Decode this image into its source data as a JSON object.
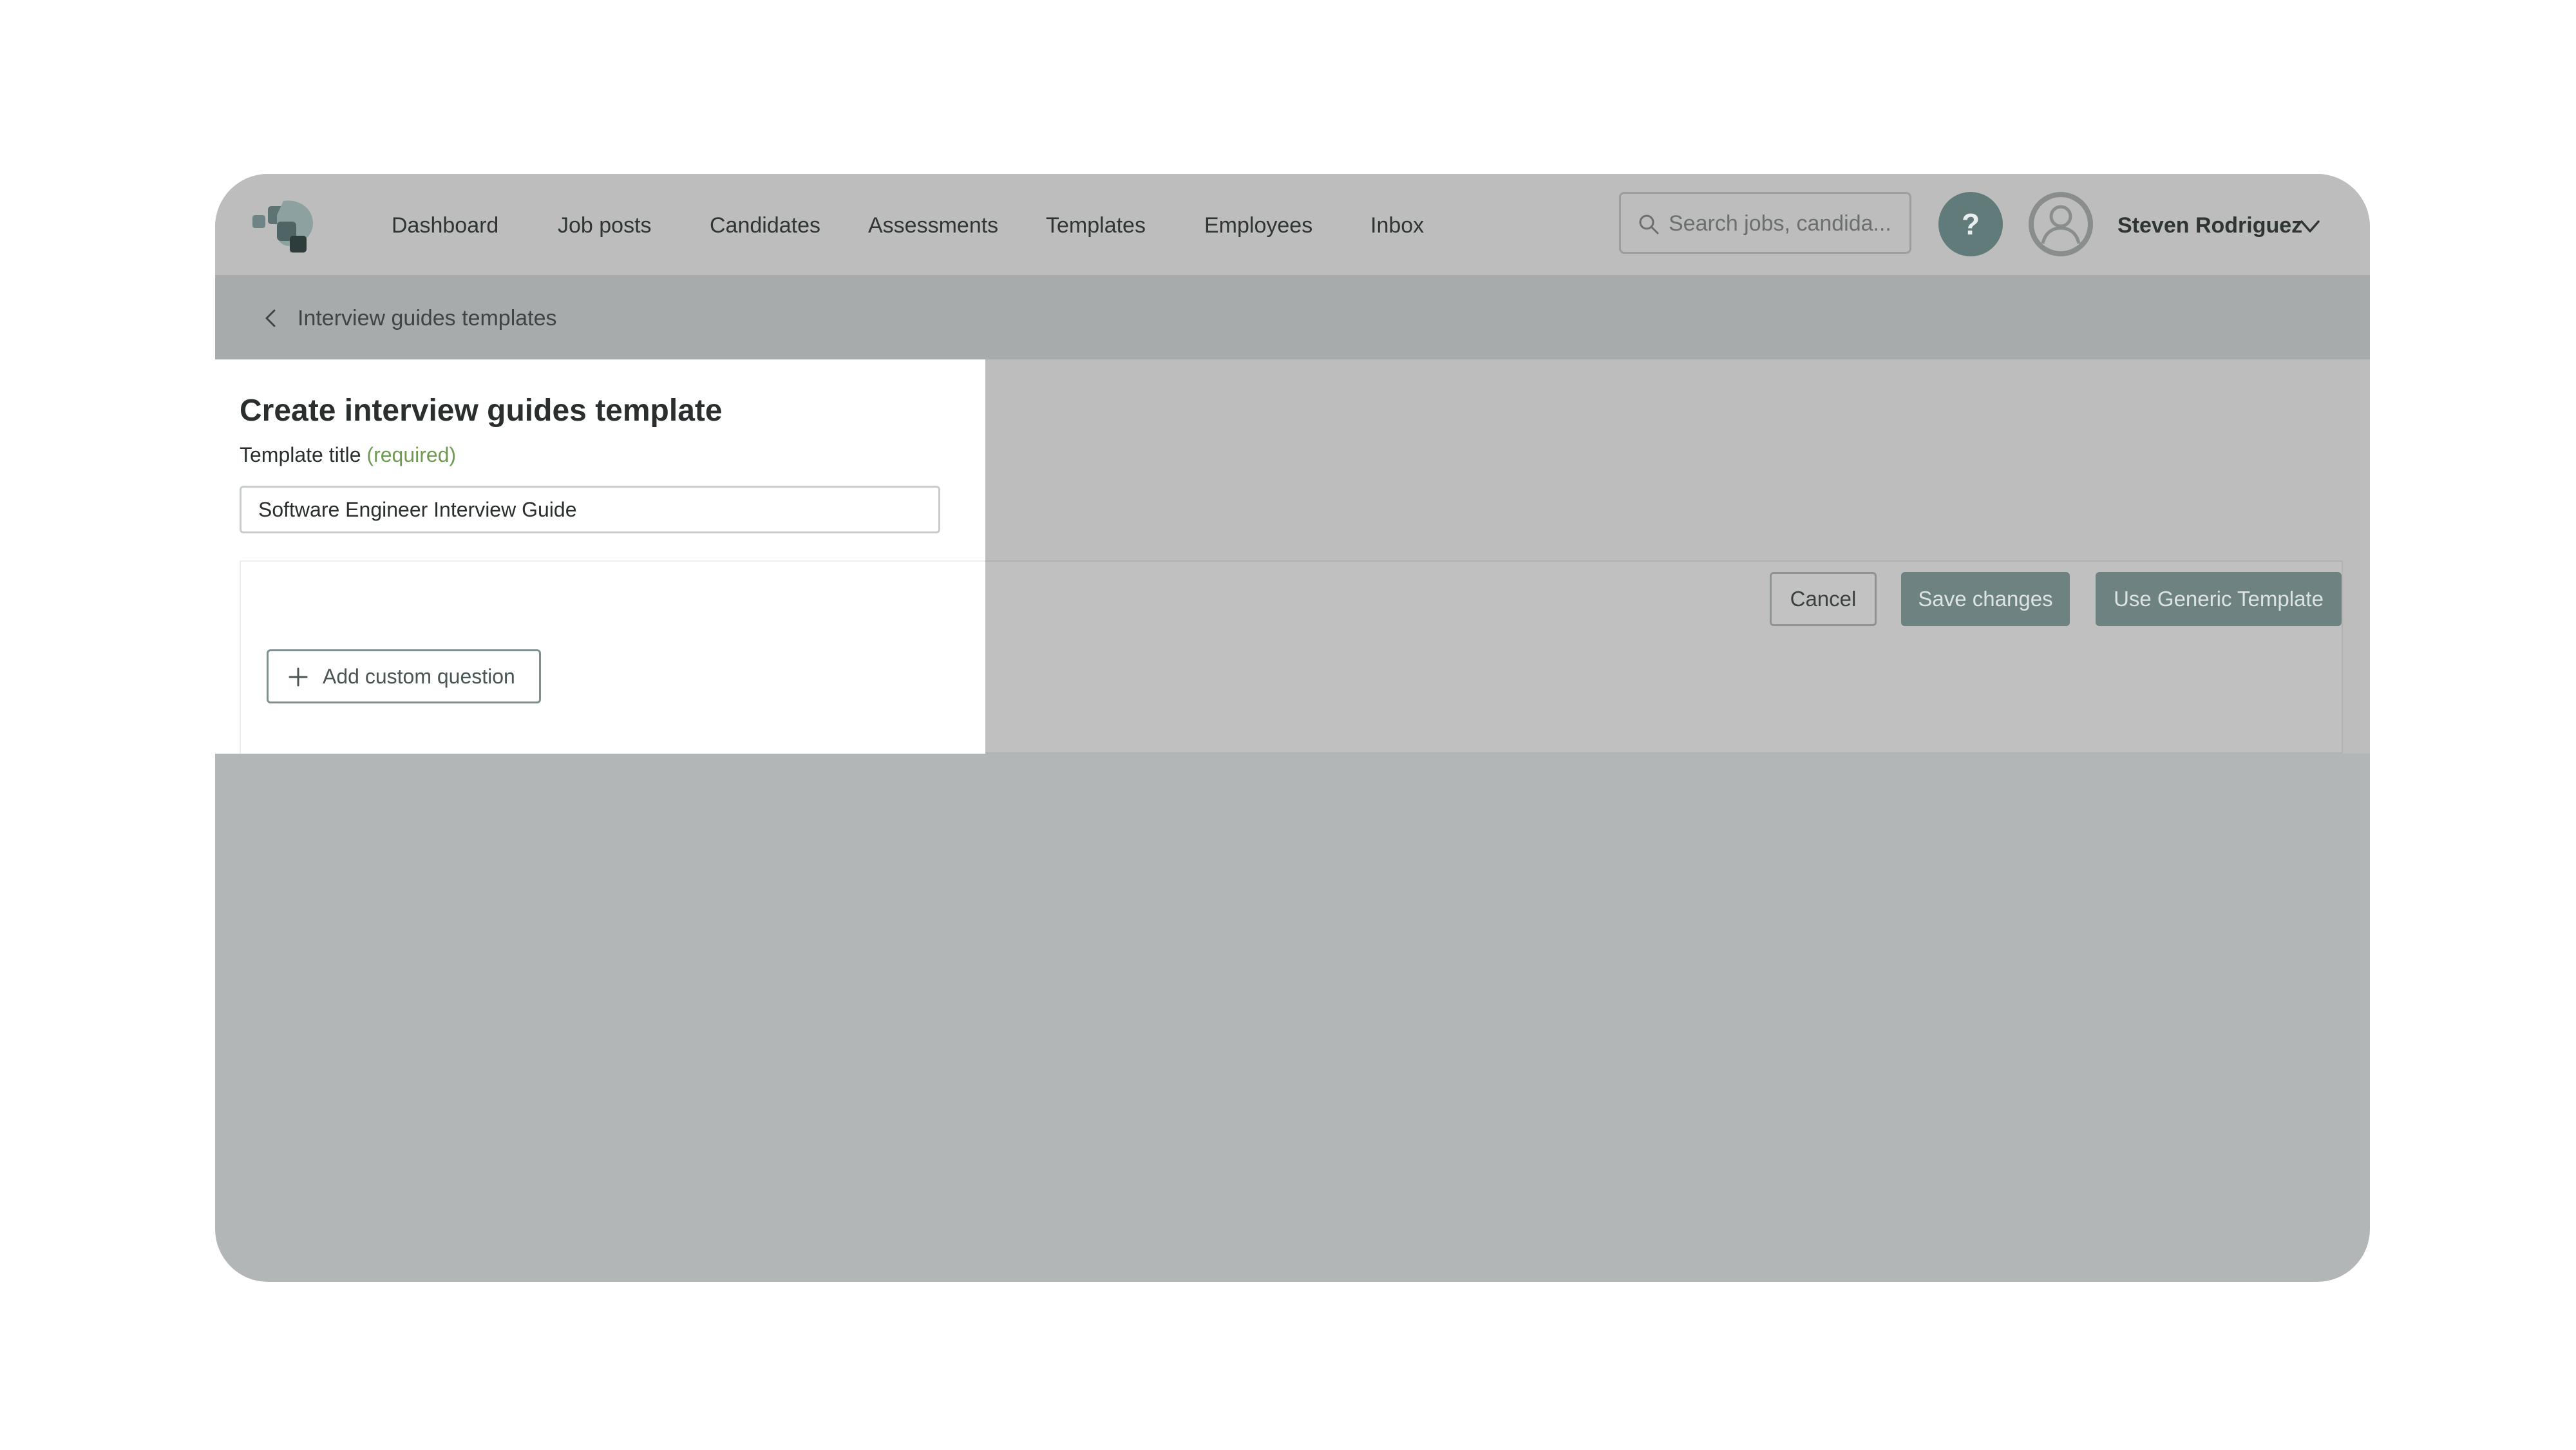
{
  "header": {
    "nav": [
      {
        "label": "Dashboard"
      },
      {
        "label": "Job posts"
      },
      {
        "label": "Candidates"
      },
      {
        "label": "Assessments"
      },
      {
        "label": "Templates"
      },
      {
        "label": "Employees"
      },
      {
        "label": "Inbox"
      }
    ],
    "search": {
      "placeholder": "Search jobs, candida..."
    },
    "help_label": "?",
    "user_name": "Steven Rodriguez"
  },
  "breadcrumb": {
    "label": "Interview guides templates"
  },
  "form": {
    "title": "Create interview guides template",
    "field_label": "Template title",
    "field_required": "(required)",
    "template_title_value": "Software Engineer Interview Guide",
    "add_question_label": "Add custom question"
  },
  "actions": {
    "cancel": "Cancel",
    "save": "Save changes",
    "use_generic": "Use Generic Template"
  },
  "colors": {
    "overlay": "#b3b6b6",
    "accent": "#6e8282",
    "required": "#6f9a53"
  }
}
